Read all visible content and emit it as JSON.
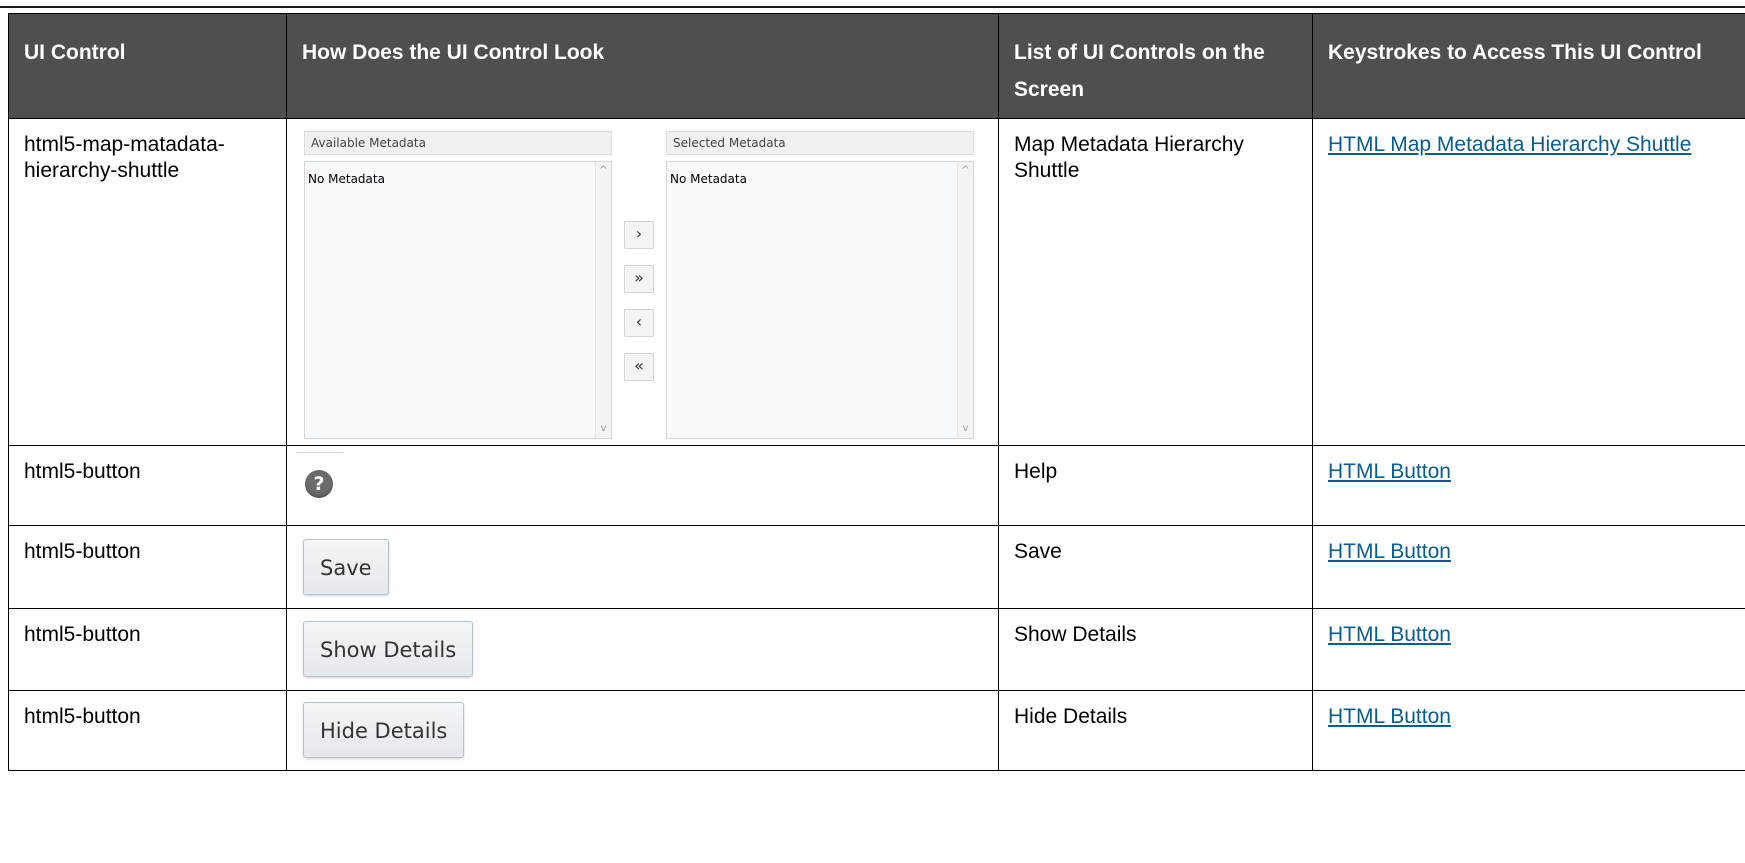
{
  "headers": {
    "ui_control": "UI Control",
    "look": "How Does the UI Control Look",
    "controls_on_screen": "List of UI Controls on the Screen",
    "keystrokes": "Keystrokes to Access This UI Control"
  },
  "rows": [
    {
      "ui_control": "html5-map-matadata-hierarchy-shuttle",
      "controls_on_screen": "Map Metadata Hierarchy Shuttle",
      "keystrokes": "HTML Map Metadata Hierarchy Shuttle"
    },
    {
      "ui_control": "html5-button",
      "controls_on_screen": "Help",
      "keystrokes": "HTML Button"
    },
    {
      "ui_control": "html5-button",
      "controls_on_screen": "Save",
      "keystrokes": "HTML Button",
      "button_label": "Save"
    },
    {
      "ui_control": "html5-button",
      "controls_on_screen": "Show Details",
      "keystrokes": "HTML Button",
      "button_label": "Show Details"
    },
    {
      "ui_control": "html5-button",
      "controls_on_screen": "Hide Details",
      "keystrokes": "HTML Button",
      "button_label": "Hide Details"
    }
  ],
  "shuttle": {
    "available_label": "Available Metadata",
    "selected_label": "Selected Metadata",
    "available_empty": "No Metadata",
    "selected_empty": "No Metadata",
    "move_one_right": "›",
    "move_all_right": "»",
    "move_one_left": "‹",
    "move_all_left": "«",
    "scroll_up": "^",
    "scroll_down": "v"
  },
  "help_icon_glyph": "?",
  "colors": {
    "header_bg": "#4f4f4f",
    "header_text": "#ffffff",
    "link": "#0b5c8a"
  }
}
